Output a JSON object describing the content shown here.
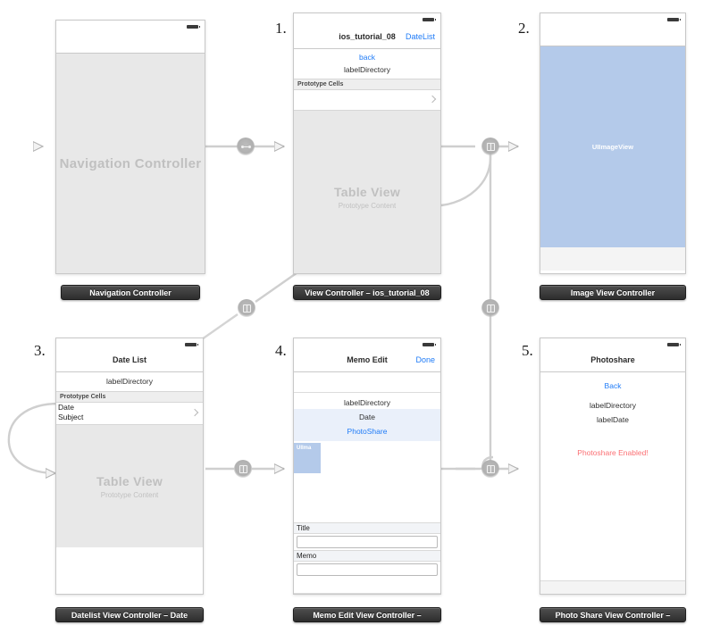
{
  "canvas": {
    "background": "#ffffff",
    "entry_arrow_label": "storyboard-entry-point"
  },
  "scenes": [
    {
      "number": "",
      "name": "navigation-controller",
      "placeholder_main": "Navigation Controller",
      "placeholder_sub": "",
      "plate": "Navigation Controller"
    },
    {
      "number": "1.",
      "name": "view-controller-ios-tutorial-08",
      "nav_title": "ios_tutorial_08",
      "nav_right": "DateList",
      "back_label": "back",
      "directory_label": "labelDirectory",
      "section_header": "Prototype Cells",
      "placeholder_main": "Table View",
      "placeholder_sub": "Prototype Content",
      "plate": "View Controller – ios_tutorial_08"
    },
    {
      "number": "2.",
      "name": "image-view-controller",
      "imageview_label": "UIImageView",
      "plate": "Image View Controller"
    },
    {
      "number": "3.",
      "name": "datelist-view-controller",
      "nav_title": "Date List",
      "directory_label": "labelDirectory",
      "section_header": "Prototype Cells",
      "cell_line_1": "Date",
      "cell_line_2": "Subject",
      "placeholder_main": "Table View",
      "placeholder_sub": "Prototype Content",
      "plate": "Datelist View Controller – Date"
    },
    {
      "number": "4.",
      "name": "memo-edit-view-controller",
      "nav_title": "Memo Edit",
      "nav_right": "Done",
      "directory_label": "labelDirectory",
      "date_label": "Date",
      "photoshare_label": "PhotoShare",
      "imageview_label": "UIIma",
      "title_field_label": "Title",
      "title_field_value": "",
      "memo_field_label": "Memo",
      "memo_field_value": "",
      "plate": "Memo Edit View Controller –"
    },
    {
      "number": "5.",
      "name": "photo-share-view-controller",
      "nav_title": "Photoshare",
      "back_label": "Back",
      "directory_label": "labelDirectory",
      "date_label": "labelDate",
      "enabled_label": "Photoshare Enabled!",
      "plate": "Photo Share View Controller –"
    }
  ],
  "segues": [
    {
      "name": "segue-nav-to-tableview",
      "kind": "relationship"
    },
    {
      "name": "segue-tableview-to-image",
      "kind": "push"
    },
    {
      "name": "segue-tableview-to-datelist",
      "kind": "push"
    },
    {
      "name": "segue-datelist-to-memoedit",
      "kind": "push"
    },
    {
      "name": "segue-memoedit-to-photoshare",
      "kind": "push"
    },
    {
      "name": "segue-memoedit-to-image",
      "kind": "push"
    }
  ],
  "colors": {
    "accent_link": "#1f7bf7",
    "alert": "#fb6f73",
    "imageview_fill": "#b4caea",
    "placeholder_fill": "#e8e8e8",
    "plate_dark": "#2d2d2d",
    "wire": "#cfcfcf"
  }
}
